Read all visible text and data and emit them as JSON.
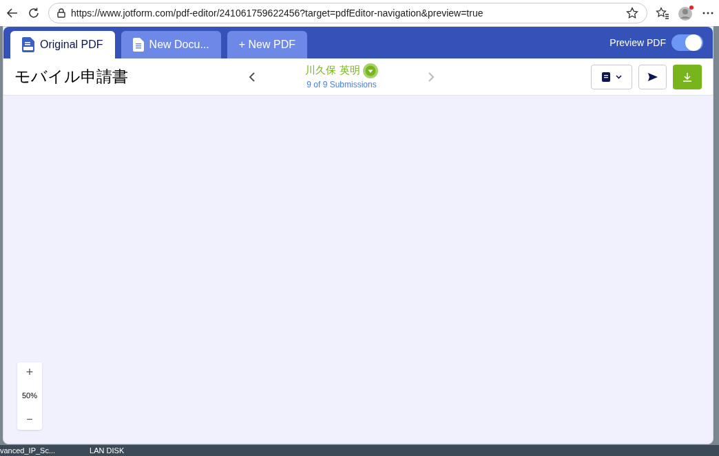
{
  "browser": {
    "url": "https://www.jotform.com/pdf-editor/241061759622456?target=pdfEditor-navigation&preview=true"
  },
  "tabs": [
    {
      "label": "Original PDF",
      "selected": true,
      "kind": "pdf"
    },
    {
      "label": "New Docu...",
      "selected": false,
      "kind": "doc"
    },
    {
      "label": "+ New PDF",
      "selected": false,
      "kind": "add"
    }
  ],
  "preview_toggle": {
    "label": "Preview PDF",
    "on": true
  },
  "document_title": "モバイル申請書",
  "submission": {
    "name": "川久保 英明",
    "count": "9 of 9 Submissions"
  },
  "zoom": {
    "plus": "+",
    "value": "50%",
    "minus": "−"
  },
  "taskbar": [
    "vanced_IP_Sc...",
    "LAN DISK"
  ]
}
